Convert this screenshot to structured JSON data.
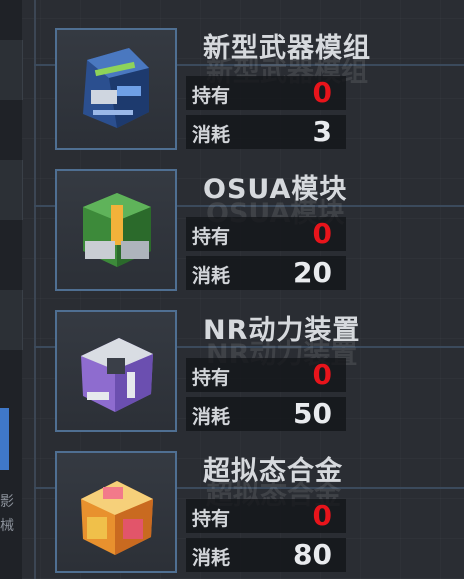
{
  "items": [
    {
      "name": "新型武器模组",
      "own_label": "持有",
      "own": "0",
      "use_label": "消耗",
      "use": "3",
      "icon": "weapon-module-icon"
    },
    {
      "name": "OSUA模块",
      "own_label": "持有",
      "own": "0",
      "use_label": "消耗",
      "use": "20",
      "icon": "osua-module-icon"
    },
    {
      "name": "NR动力装置",
      "own_label": "持有",
      "own": "0",
      "use_label": "消耗",
      "use": "50",
      "icon": "nr-power-unit-icon"
    },
    {
      "name": "超拟态合金",
      "own_label": "持有",
      "own": "0",
      "use_label": "消耗",
      "use": "80",
      "icon": "mimetic-alloy-icon"
    }
  ],
  "side_label": "影\n械",
  "colors": {
    "owned_zero": "#e8141b",
    "frame": "#4f6f92",
    "accent_tab": "#3f78c8"
  }
}
